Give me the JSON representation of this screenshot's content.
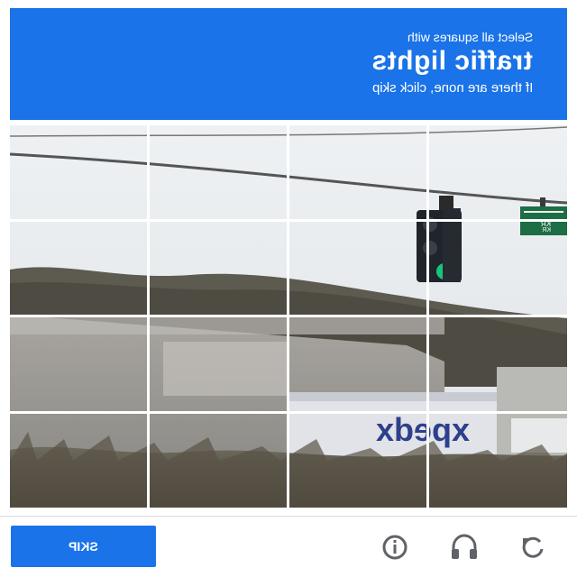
{
  "header": {
    "line1": "Select all squares with",
    "line2": "traffic lights",
    "line3": "If there are none, click skip"
  },
  "grid": {
    "rows": 4,
    "cols": 4
  },
  "footer": {
    "skip_label": "SKIP",
    "icons": [
      "refresh-icon",
      "audio-icon",
      "info-icon"
    ]
  },
  "scene_signs": {
    "truck_logo": "xpedx",
    "street_sign_1": "KR",
    "street_sign_2": "KR"
  },
  "colors": {
    "accent": "#1a73e8",
    "signal_green": "#16c47c"
  }
}
